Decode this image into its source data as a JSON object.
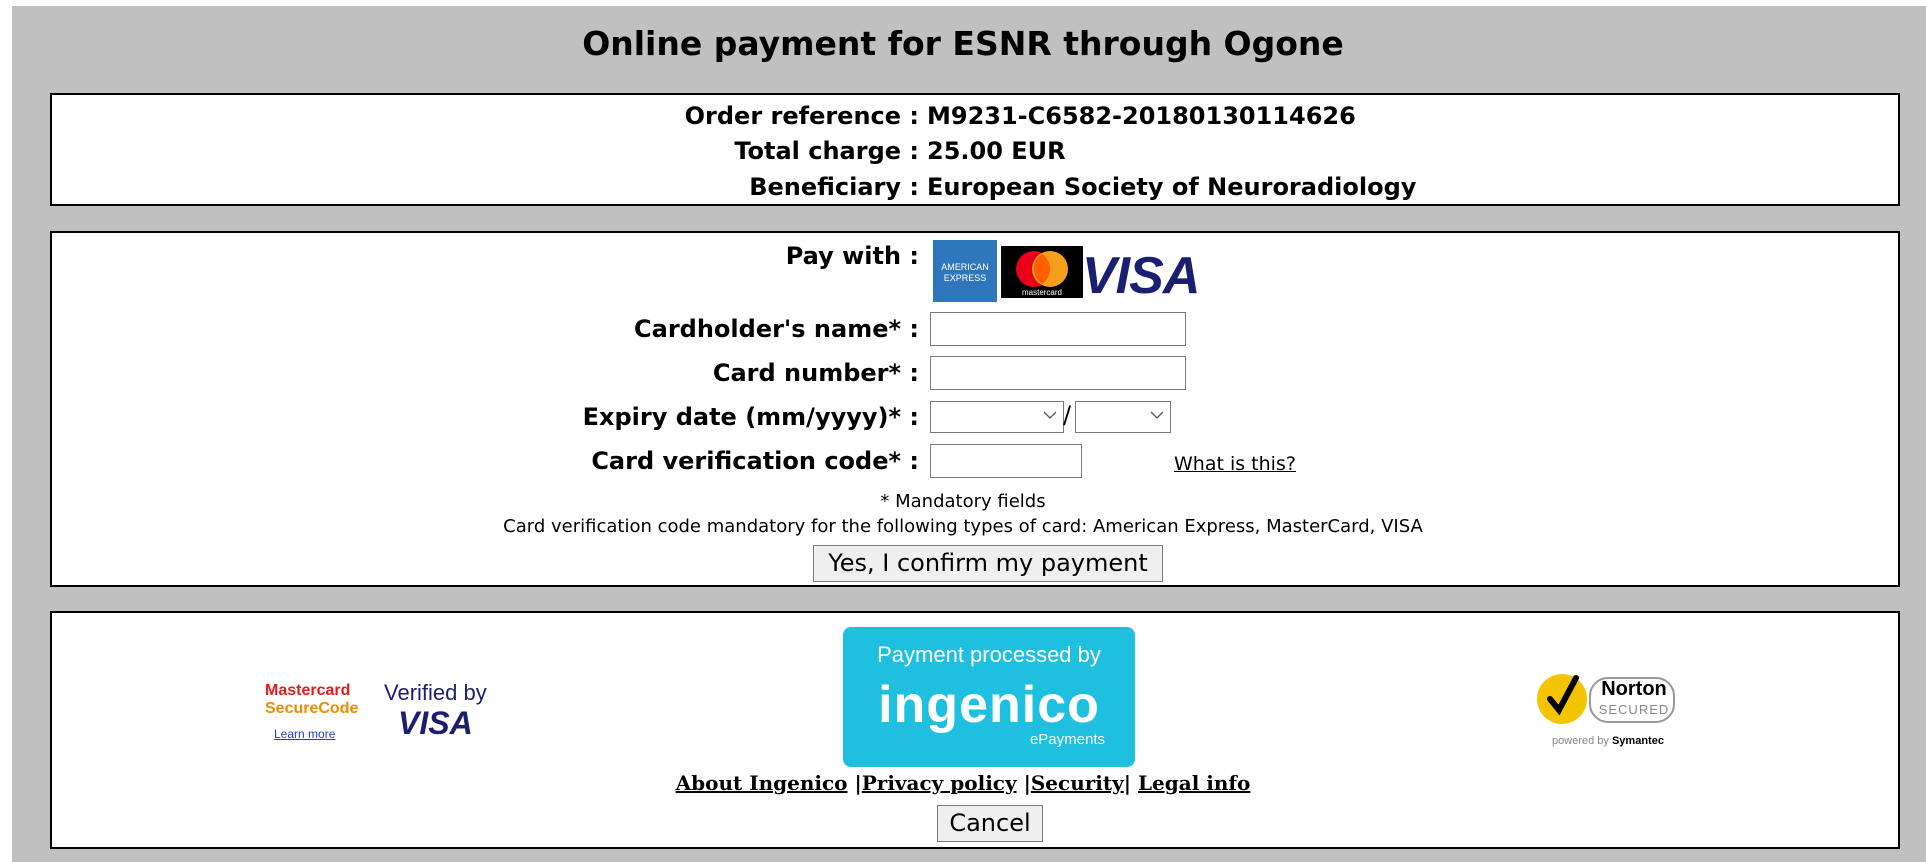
{
  "title": "Online payment for ESNR through Ogone",
  "order": {
    "reference_label": "Order reference :",
    "reference_value": "M9231-C6582-20180130114626",
    "charge_label": "Total charge :",
    "charge_value": "25.00 EUR",
    "beneficiary_label": "Beneficiary :",
    "beneficiary_value": "European Society of Neuroradiology"
  },
  "payment": {
    "pay_with_label": "Pay with :",
    "cards": [
      "American Express",
      "MasterCard",
      "VISA"
    ],
    "amex_text_1": "AMERICAN",
    "amex_text_2": "EXPRESS",
    "mc_text": "mastercard",
    "visa_text": "VISA",
    "cardholder_label": "Cardholder's name* :",
    "cardholder_value": "",
    "card_number_label": "Card number* :",
    "card_number_value": "",
    "expiry_label": "Expiry date (mm/yyyy)* :",
    "expiry_month_value": "",
    "expiry_year_value": "",
    "expiry_separator": "/",
    "cvc_label": "Card verification code* :",
    "cvc_value": "",
    "what_is_this": "What is this?",
    "mandatory_note": "* Mandatory fields",
    "cvc_note": "Card verification code mandatory for the following types of card: American Express, MasterCard, VISA",
    "confirm_button": "Yes, I confirm my payment"
  },
  "footer": {
    "mc_secure_1": "Mastercard",
    "mc_secure_2": "SecureCode",
    "learn_more": "Learn more",
    "verified_by": "Verified by",
    "verified_visa": "VISA",
    "ingenico_top": "Payment processed by",
    "ingenico_brand": "ingenico",
    "ingenico_sub": "ePayments",
    "norton_name": "Norton",
    "norton_secured": "SECURED",
    "norton_powered": "powered by",
    "norton_symantec": "Symantec",
    "links": [
      "About Ingenico",
      "Privacy policy",
      "Security",
      "Legal info"
    ],
    "cancel_button": "Cancel"
  },
  "colors": {
    "background": "#c0c0c0",
    "amex_blue": "#2e77bb",
    "visa_navy": "#1a1f71",
    "ingenico_cyan": "#1fbfe0",
    "norton_yellow": "#f5c400"
  }
}
